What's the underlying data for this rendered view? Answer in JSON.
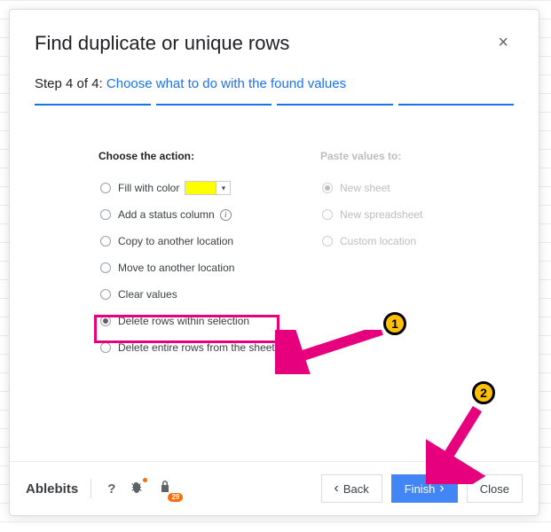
{
  "dialog": {
    "title": "Find duplicate or unique rows",
    "step_prefix": "Step 4 of 4: ",
    "step_link": "Choose what to do with the found values"
  },
  "actions": {
    "heading": "Choose the action:",
    "fill_color": "Fill with color",
    "add_status": "Add a status column",
    "copy_loc": "Copy to another location",
    "move_loc": "Move to another location",
    "clear_vals": "Clear values",
    "delete_sel": "Delete rows within selection",
    "delete_all": "Delete entire rows from the sheet"
  },
  "paste": {
    "heading": "Paste values to:",
    "new_sheet": "New sheet",
    "new_ss": "New spreadsheet",
    "custom": "Custom location"
  },
  "footer": {
    "brand": "Ablebits",
    "badge": "29",
    "back": "Back",
    "finish": "Finish",
    "close": "Close"
  },
  "annotations": {
    "m1": "1",
    "m2": "2"
  }
}
